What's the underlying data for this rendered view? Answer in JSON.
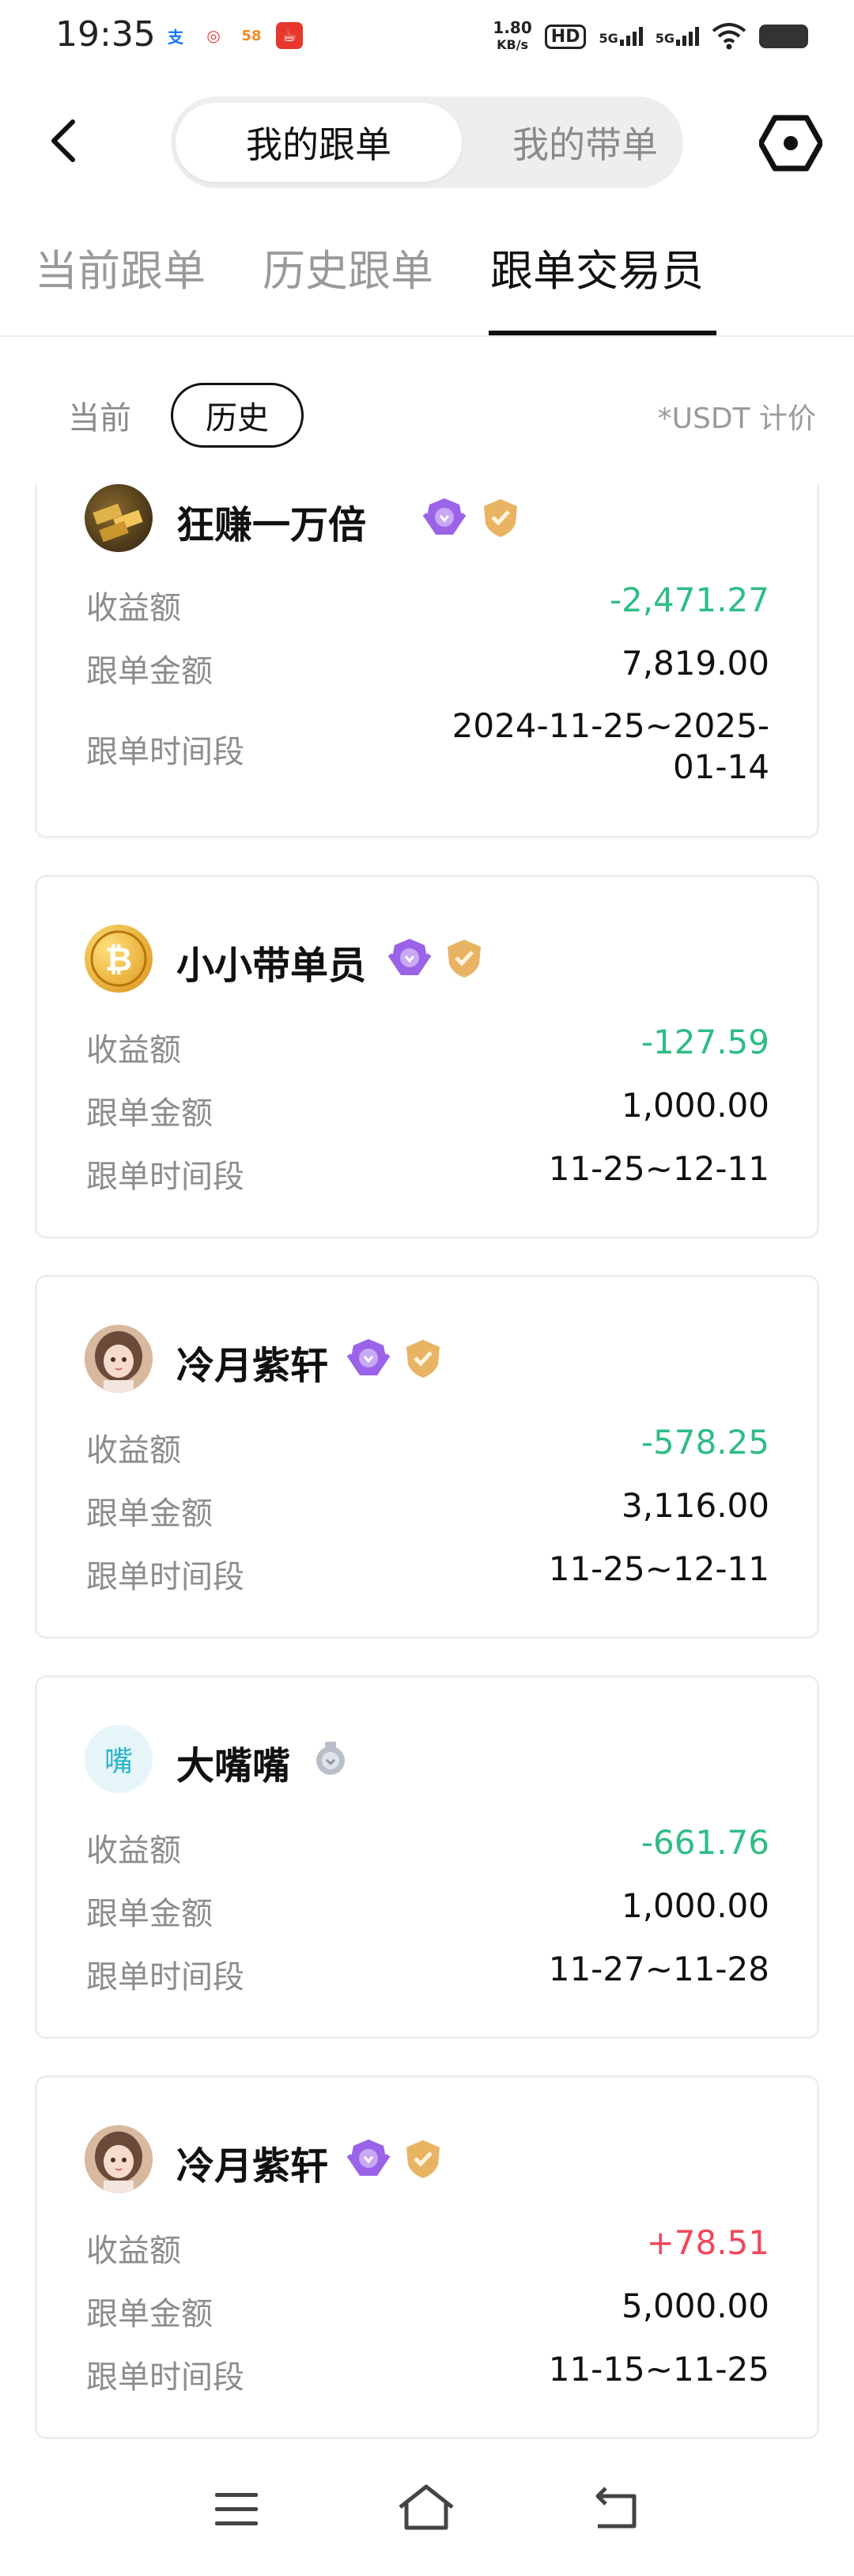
{
  "status_bar": {
    "time": "19:35",
    "app_icons": [
      "支",
      "◎",
      "58",
      "☕"
    ],
    "net_speed_value": "1.80",
    "net_speed_unit": "KB/s",
    "hd": "HD",
    "signal_1": "5G",
    "signal_2": "5G"
  },
  "header": {
    "segment_active": "我的跟单",
    "segment_inactive": "我的带单"
  },
  "tabs": [
    "当前跟单",
    "历史跟单",
    "跟单交易员"
  ],
  "sub_toggle": {
    "current": "当前",
    "history": "历史"
  },
  "unit_note": "*USDT 计价",
  "labels": {
    "profit": "收益额",
    "amount": "跟单金额",
    "period": "跟单时间段"
  },
  "traders": [
    {
      "name": "狂赚一万倍",
      "profit": "-2,471.27",
      "amount": "7,819.00",
      "period_line1": "2024-11-25~2025-",
      "period_line2": "01-14",
      "avatar": "gold-bars"
    },
    {
      "name": "小小带单员",
      "profit": "-127.59",
      "amount": "1,000.00",
      "period": "11-25~12-11",
      "avatar": "bitcoin"
    },
    {
      "name": "冷月紫轩",
      "profit": "-578.25",
      "amount": "3,116.00",
      "period": "11-25~12-11",
      "avatar": "girl"
    },
    {
      "name": "大嘴嘴",
      "profit": "-661.76",
      "amount": "1,000.00",
      "period": "11-27~11-28",
      "avatar": "text",
      "avatar_text": "嘴"
    },
    {
      "name": "冷月紫轩",
      "profit": "+78.51",
      "amount": "5,000.00",
      "period": "11-15~11-25",
      "avatar": "girl"
    }
  ],
  "colors": {
    "loss": "#2ebd85",
    "gain": "#f0475a",
    "badge_purple": "#9a63e8",
    "badge_gold": "#e8b463"
  }
}
